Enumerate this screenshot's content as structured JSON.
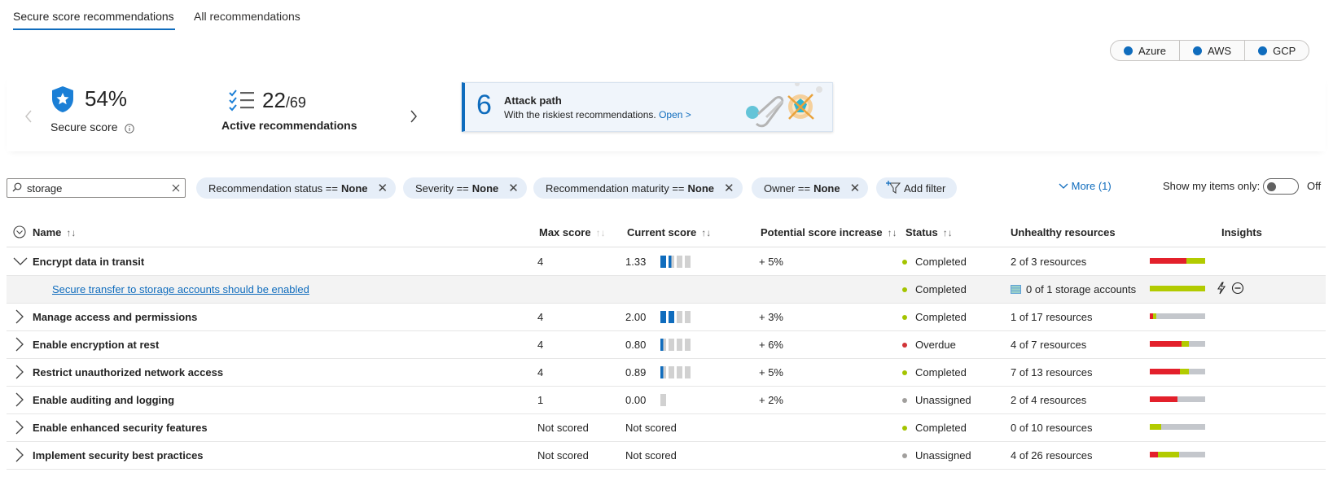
{
  "tabs": [
    {
      "label": "Secure score recommendations",
      "active": true
    },
    {
      "label": "All recommendations",
      "active": false
    }
  ],
  "clouds": [
    "Azure",
    "AWS",
    "GCP"
  ],
  "summary": {
    "secure_score_value": "54%",
    "secure_score_label": "Secure score",
    "active_count": "22",
    "active_total": "/69",
    "active_label": "Active recommendations"
  },
  "attack_path": {
    "count": "6",
    "title": "Attack path",
    "subtitle": "With the riskiest recommendations.",
    "link": "Open >"
  },
  "filters": {
    "search_value": "storage",
    "chips": [
      {
        "key": "Recommendation status ==",
        "value": "None"
      },
      {
        "key": "Severity ==",
        "value": "None"
      },
      {
        "key": "Recommendation maturity ==",
        "value": "None"
      },
      {
        "key": "Owner ==",
        "value": "None"
      }
    ],
    "add_filter": "Add filter",
    "more": "More (1)",
    "show_mine_label": "Show my items only:",
    "toggle_state": "Off"
  },
  "table": {
    "columns": [
      "Name",
      "Max score",
      "Current score",
      "Potential score increase",
      "Status",
      "Unhealthy resources",
      "Insights"
    ],
    "rows": [
      {
        "name": "Encrypt data in transit",
        "expanded": true,
        "max": "4",
        "current": "1.33",
        "bars": 1.33,
        "potential": "+ 5%",
        "status": "Completed",
        "status_color": "#a4c400",
        "unhealthy": "2 of 3 resources",
        "health": [
          0.66,
          0.34,
          0
        ]
      },
      {
        "name": "Secure transfer to storage accounts should be enabled",
        "sub": true,
        "max": "",
        "current": "",
        "potential": "",
        "status": "Completed",
        "status_color": "#a4c400",
        "unhealthy": "0 of 1 storage accounts",
        "health": [
          0,
          1,
          0
        ]
      },
      {
        "name": "Manage access and permissions",
        "max": "4",
        "current": "2.00",
        "bars": 2,
        "potential": "+ 3%",
        "status": "Completed",
        "status_color": "#a4c400",
        "unhealthy": "1 of 17 resources",
        "health": [
          0.06,
          0.06,
          0.88
        ]
      },
      {
        "name": "Enable encryption at rest",
        "max": "4",
        "current": "0.80",
        "bars": 0.8,
        "potential": "+ 6%",
        "status": "Overdue",
        "status_color": "#d13438",
        "unhealthy": "4 of 7 resources",
        "health": [
          0.57,
          0.14,
          0.29
        ]
      },
      {
        "name": "Restrict unauthorized network access",
        "max": "4",
        "current": "0.89",
        "bars": 0.89,
        "potential": "+ 5%",
        "status": "Completed",
        "status_color": "#a4c400",
        "unhealthy": "7 of 13 resources",
        "health": [
          0.54,
          0.16,
          0.3
        ]
      },
      {
        "name": "Enable auditing and logging",
        "max": "1",
        "current": "0.00",
        "bars": 0,
        "potential": "+ 2%",
        "status": "Unassigned",
        "status_color": "#a19f9d",
        "unhealthy": "2 of 4 resources",
        "health": [
          0.5,
          0,
          0.5
        ]
      },
      {
        "name": "Enable enhanced security features",
        "max": "Not scored",
        "current": "Not scored",
        "potential": "",
        "status": "Completed",
        "status_color": "#a4c400",
        "unhealthy": "0 of 10 resources",
        "health": [
          0,
          0.2,
          0.8
        ]
      },
      {
        "name": "Implement security best practices",
        "max": "Not scored",
        "current": "Not scored",
        "potential": "",
        "status": "Unassigned",
        "status_color": "#a19f9d",
        "unhealthy": "4 of 26 resources",
        "health": [
          0.15,
          0.38,
          0.47
        ]
      }
    ]
  },
  "colors": {
    "accent": "#0f6cbd",
    "unhealthy": "#e3202b",
    "healthy": "#b2cb00",
    "neutral": "#c4c7cc"
  }
}
